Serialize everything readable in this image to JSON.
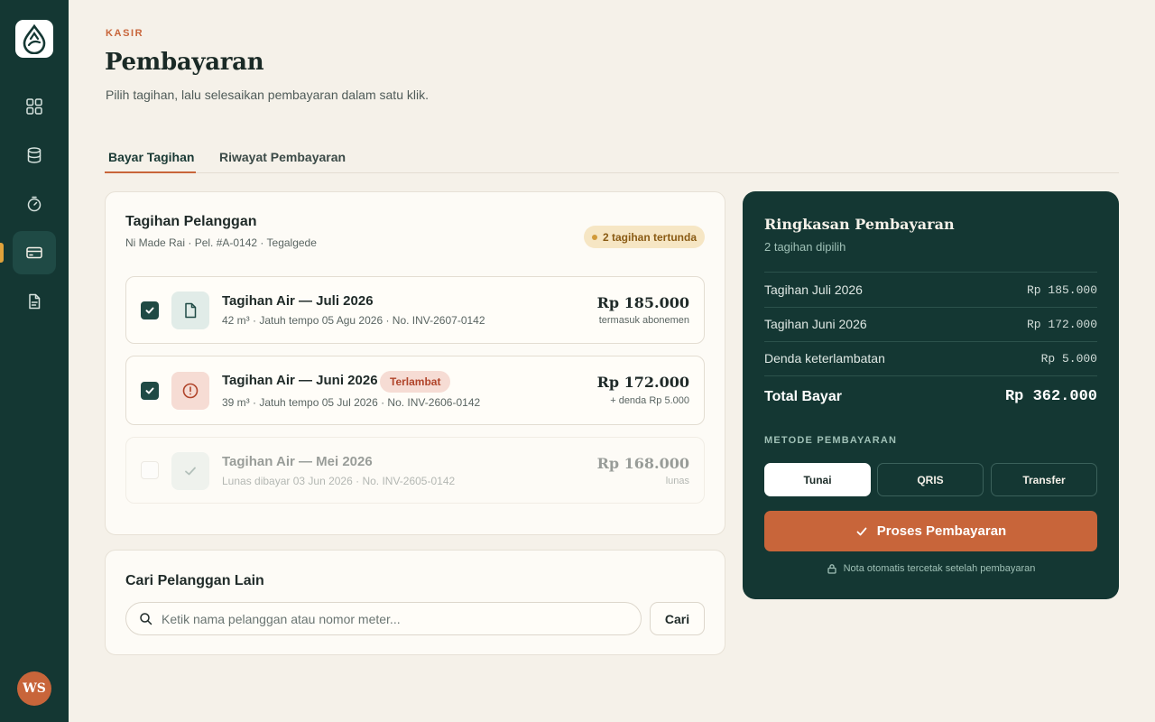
{
  "header": {
    "eyebrow": "KASIR",
    "title": "Pembayaran",
    "subtitle": "Pilih tagihan, lalu selesaikan pembayaran dalam satu klik."
  },
  "sidebar": {
    "logo_icon": "water-drop-logo-icon",
    "items": [
      {
        "name": "dashboard",
        "icon": "grid-icon",
        "active": false
      },
      {
        "name": "data",
        "icon": "database-icon",
        "active": false
      },
      {
        "name": "meter",
        "icon": "timer-icon",
        "active": false
      },
      {
        "name": "payment",
        "icon": "credit-card-icon",
        "active": true
      },
      {
        "name": "reports",
        "icon": "document-icon",
        "active": false
      }
    ],
    "avatar_initials": "WS"
  },
  "tabs": [
    {
      "label": "Bayar Tagihan",
      "active": true
    },
    {
      "label": "Riwayat Pembayaran",
      "active": false
    }
  ],
  "bills_card": {
    "title": "Tagihan Pelanggan",
    "customer": "Ni Made Rai · Pel. #A-0142 · Tegalgede",
    "pending_badge": "2 tagihan tertunda",
    "bills": [
      {
        "name": "Tagihan Air — Juli 2026",
        "meta": "42 m³ · Jatuh tempo 05 Agu 2026 · No. INV-2607-0142",
        "amount": "Rp 185.000",
        "note": "termasuk abonemen",
        "checked": true,
        "status": "due",
        "icon": "document-icon"
      },
      {
        "name": "Tagihan Air — Juni 2026",
        "badge": "Terlambat",
        "meta": "39 m³ · Jatuh tempo 05 Jul 2026 · No. INV-2606-0142",
        "amount": "Rp 172.000",
        "note": "+ denda Rp 5.000",
        "checked": true,
        "status": "late",
        "icon": "alert-circle-icon"
      },
      {
        "name": "Tagihan Air — Mei 2026",
        "meta": "Lunas dibayar 03 Jun 2026 · No. INV-2605-0142",
        "amount": "Rp 168.000",
        "note": "lunas",
        "checked": false,
        "status": "paid",
        "icon": "check-icon"
      }
    ]
  },
  "search_card": {
    "title": "Cari Pelanggan Lain",
    "placeholder": "Ketik nama pelanggan atau nomor meter...",
    "button": "Cari"
  },
  "summary": {
    "title": "Ringkasan Pembayaran",
    "subtitle": "2 tagihan dipilih",
    "rows": [
      {
        "label": "Tagihan Juli 2026",
        "value": "Rp 185.000"
      },
      {
        "label": "Tagihan Juni 2026",
        "value": "Rp 172.000"
      },
      {
        "label": "Denda keterlambatan",
        "value": "Rp 5.000"
      }
    ],
    "total_label": "Total Bayar",
    "total_value": "Rp 362.000",
    "method_label": "METODE PEMBAYARAN",
    "methods": [
      {
        "label": "Tunai",
        "active": true
      },
      {
        "label": "QRIS",
        "active": false
      },
      {
        "label": "Transfer",
        "active": false
      }
    ],
    "process_button": "Proses Pembayaran",
    "receipt_note": "Nota otomatis tercetak setelah pembayaran"
  },
  "colors": {
    "sidebar_bg": "#143733",
    "accent": "#c8653a",
    "page_bg": "#f5f1e9",
    "pending": "#f6e6c4",
    "late": "#f6dcd4"
  }
}
